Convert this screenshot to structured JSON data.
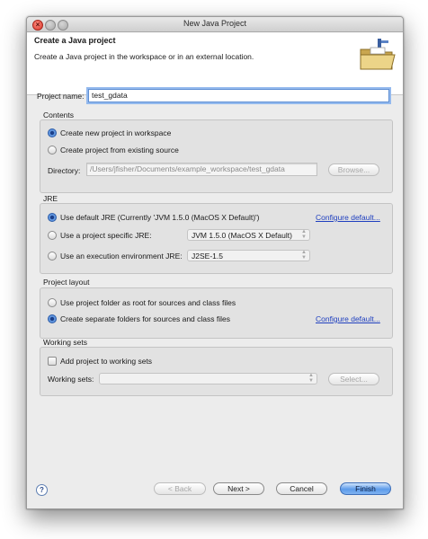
{
  "window": {
    "title": "New Java Project"
  },
  "header": {
    "title": "Create a Java project",
    "description": "Create a Java project in the workspace or in an external location."
  },
  "project_name": {
    "label": "Project name:",
    "value": "test_gdata"
  },
  "contents": {
    "title": "Contents",
    "new_project": "Create new project in workspace",
    "existing_source": "Create project from existing source",
    "directory_label": "Directory:",
    "directory_value": "/Users/jfisher/Documents/example_workspace/test_gdata",
    "browse": "Browse..."
  },
  "jre": {
    "title": "JRE",
    "default_jre": "Use default JRE (Currently 'JVM 1.5.0 (MacOS X Default)')",
    "configure_default": "Configure default...",
    "specific_jre": "Use a project specific JRE:",
    "specific_jre_value": "JVM 1.5.0 (MacOS X Default)",
    "exec_env": "Use an execution environment JRE:",
    "exec_env_value": "J2SE-1.5"
  },
  "layout": {
    "title": "Project layout",
    "folder_root": "Use project folder as root for sources and class files",
    "separate_folders": "Create separate folders for sources and class files",
    "configure_default": "Configure default..."
  },
  "working_sets": {
    "title": "Working sets",
    "add_to": "Add project to working sets",
    "label": "Working sets:",
    "value": "",
    "select": "Select..."
  },
  "footer": {
    "help": "?",
    "back": "< Back",
    "next": "Next >",
    "cancel": "Cancel",
    "finish": "Finish"
  }
}
